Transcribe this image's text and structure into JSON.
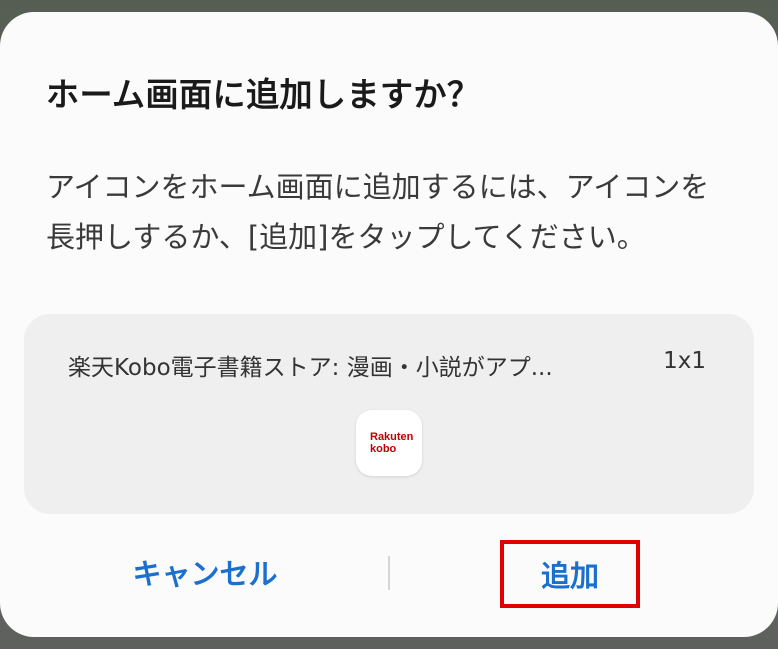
{
  "dialog": {
    "title": "ホーム画面に追加しますか？",
    "body": "アイコンをホーム画面に追加するには、アイコンを長押しするか、[追加]をタップしてください。"
  },
  "widget": {
    "name": "楽天Kobo電子書籍ストア: 漫画・小説がアプ...",
    "size": "1x1",
    "icon": "rakuten-kobo-app-icon",
    "logo_line1": "Rakuten",
    "logo_line2": "kobo",
    "logo_color": "#bf0000"
  },
  "actions": {
    "cancel_label": "キャンセル",
    "add_label": "追加",
    "accent_color": "#1a6fcf",
    "highlight_color": "#e00000"
  }
}
